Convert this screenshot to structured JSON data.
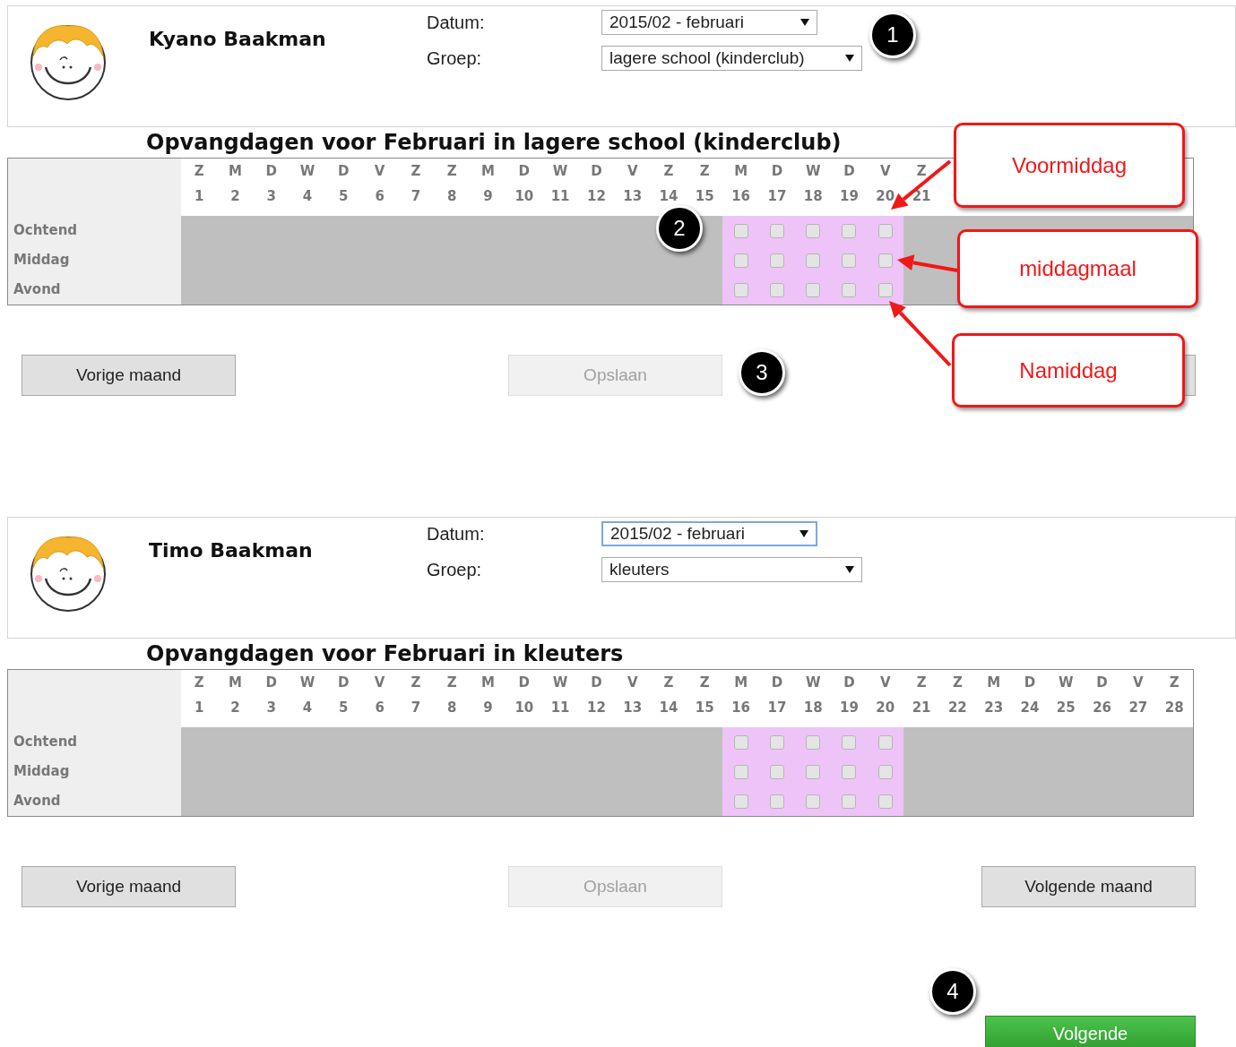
{
  "children": [
    {
      "name": "Kyano Baakman",
      "date": {
        "label": "Datum:",
        "value": "2015/02 - februari",
        "focused": false
      },
      "group": {
        "label": "Groep:",
        "value": "lagere school (kinderclub)",
        "focused": false
      },
      "title": "Opvangdagen voor Februari in lagere school (kinderclub)",
      "calendar": {
        "rows": [
          "Ochtend",
          "Middag",
          "Avond"
        ],
        "days": [
          {
            "weekday": "Z",
            "day": "1",
            "open": false
          },
          {
            "weekday": "M",
            "day": "2",
            "open": false
          },
          {
            "weekday": "D",
            "day": "3",
            "open": false
          },
          {
            "weekday": "W",
            "day": "4",
            "open": false
          },
          {
            "weekday": "D",
            "day": "5",
            "open": false
          },
          {
            "weekday": "V",
            "day": "6",
            "open": false
          },
          {
            "weekday": "Z",
            "day": "7",
            "open": false
          },
          {
            "weekday": "Z",
            "day": "8",
            "open": false
          },
          {
            "weekday": "M",
            "day": "9",
            "open": false
          },
          {
            "weekday": "D",
            "day": "10",
            "open": false
          },
          {
            "weekday": "W",
            "day": "11",
            "open": false
          },
          {
            "weekday": "D",
            "day": "12",
            "open": false
          },
          {
            "weekday": "V",
            "day": "13",
            "open": false
          },
          {
            "weekday": "Z",
            "day": "14",
            "open": false
          },
          {
            "weekday": "Z",
            "day": "15",
            "open": false
          },
          {
            "weekday": "M",
            "day": "16",
            "open": true,
            "checked": [
              false,
              false,
              false
            ]
          },
          {
            "weekday": "D",
            "day": "17",
            "open": true,
            "checked": [
              false,
              false,
              false
            ]
          },
          {
            "weekday": "W",
            "day": "18",
            "open": true,
            "checked": [
              false,
              false,
              false
            ]
          },
          {
            "weekday": "D",
            "day": "19",
            "open": true,
            "checked": [
              false,
              false,
              false
            ]
          },
          {
            "weekday": "V",
            "day": "20",
            "open": true,
            "checked": [
              false,
              false,
              false
            ]
          },
          {
            "weekday": "Z",
            "day": "21",
            "open": false
          }
        ]
      },
      "buttons": [
        {
          "kind": "prev",
          "label": "Vorige maand",
          "disabled": false
        },
        {
          "kind": "save",
          "label": "Opslaan",
          "disabled": true
        },
        {
          "kind": "next",
          "disabled": false
        }
      ]
    },
    {
      "name": "Timo Baakman",
      "date": {
        "label": "Datum:",
        "value": "2015/02 - februari",
        "focused": true
      },
      "group": {
        "label": "Groep:",
        "value": "kleuters",
        "focused": false
      },
      "title": "Opvangdagen voor Februari in kleuters",
      "calendar": {
        "rows": [
          "Ochtend",
          "Middag",
          "Avond"
        ],
        "days": [
          {
            "weekday": "Z",
            "day": "1",
            "open": false
          },
          {
            "weekday": "M",
            "day": "2",
            "open": false
          },
          {
            "weekday": "D",
            "day": "3",
            "open": false
          },
          {
            "weekday": "W",
            "day": "4",
            "open": false
          },
          {
            "weekday": "D",
            "day": "5",
            "open": false
          },
          {
            "weekday": "V",
            "day": "6",
            "open": false
          },
          {
            "weekday": "Z",
            "day": "7",
            "open": false
          },
          {
            "weekday": "Z",
            "day": "8",
            "open": false
          },
          {
            "weekday": "M",
            "day": "9",
            "open": false
          },
          {
            "weekday": "D",
            "day": "10",
            "open": false
          },
          {
            "weekday": "W",
            "day": "11",
            "open": false
          },
          {
            "weekday": "D",
            "day": "12",
            "open": false
          },
          {
            "weekday": "V",
            "day": "13",
            "open": false
          },
          {
            "weekday": "Z",
            "day": "14",
            "open": false
          },
          {
            "weekday": "Z",
            "day": "15",
            "open": false
          },
          {
            "weekday": "M",
            "day": "16",
            "open": true,
            "checked": [
              false,
              false,
              false
            ]
          },
          {
            "weekday": "D",
            "day": "17",
            "open": true,
            "checked": [
              false,
              false,
              false
            ]
          },
          {
            "weekday": "W",
            "day": "18",
            "open": true,
            "checked": [
              false,
              false,
              false
            ]
          },
          {
            "weekday": "D",
            "day": "19",
            "open": true,
            "checked": [
              false,
              false,
              false
            ]
          },
          {
            "weekday": "V",
            "day": "20",
            "open": true,
            "checked": [
              false,
              false,
              false
            ]
          },
          {
            "weekday": "Z",
            "day": "21",
            "open": false
          },
          {
            "weekday": "Z",
            "day": "22",
            "open": false
          },
          {
            "weekday": "M",
            "day": "23",
            "open": false
          },
          {
            "weekday": "D",
            "day": "24",
            "open": false
          },
          {
            "weekday": "W",
            "day": "25",
            "open": false
          },
          {
            "weekday": "D",
            "day": "26",
            "open": false
          },
          {
            "weekday": "V",
            "day": "27",
            "open": false
          },
          {
            "weekday": "Z",
            "day": "28",
            "open": false
          }
        ]
      },
      "buttons": [
        {
          "kind": "prev",
          "label": "Vorige maand",
          "disabled": false
        },
        {
          "kind": "save",
          "label": "Opslaan",
          "disabled": true
        },
        {
          "kind": "next",
          "label": "Volgende maand",
          "disabled": false
        }
      ]
    }
  ],
  "next_button": {
    "label": "Volgende"
  },
  "annotations": {
    "badges": [
      "1",
      "2",
      "3",
      "4"
    ],
    "callouts": [
      "Voormiddag",
      "middagmaal",
      "Namiddag"
    ]
  }
}
